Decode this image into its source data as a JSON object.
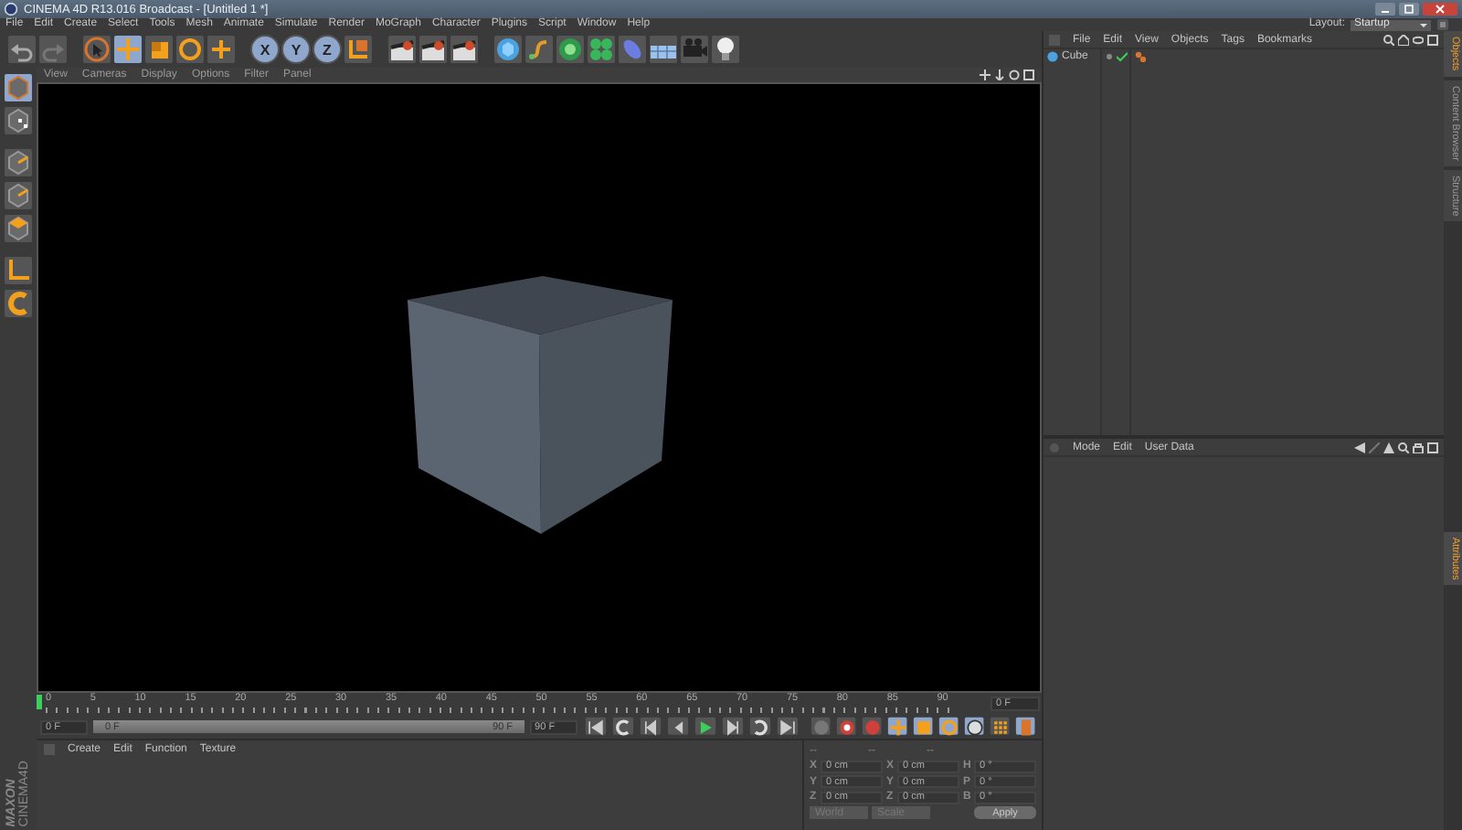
{
  "window": {
    "title": "CINEMA 4D R13.016 Broadcast - [Untitled 1 *]"
  },
  "menu": [
    "File",
    "Edit",
    "Create",
    "Select",
    "Tools",
    "Mesh",
    "Animate",
    "Simulate",
    "Render",
    "MoGraph",
    "Character",
    "Plugins",
    "Script",
    "Window",
    "Help"
  ],
  "layout": {
    "label": "Layout:",
    "value": "Startup"
  },
  "toolbar": {
    "axis_buttons": [
      {
        "label": "X",
        "selected": true
      },
      {
        "label": "Y",
        "selected": true
      },
      {
        "label": "Z",
        "selected": true
      }
    ]
  },
  "viewport": {
    "menu": [
      "View",
      "Cameras",
      "Display",
      "Options",
      "Filter",
      "Panel"
    ]
  },
  "timeline": {
    "ticks": [
      "0",
      "5",
      "10",
      "15",
      "20",
      "25",
      "30",
      "35",
      "40",
      "45",
      "50",
      "55",
      "60",
      "65",
      "70",
      "75",
      "80",
      "85",
      "90"
    ],
    "current_frame": "0 F",
    "start_field": "0 F",
    "range_slider": {
      "start": "0 F",
      "end": "90 F",
      "level": 1
    },
    "end_field": "90 F"
  },
  "materials": {
    "menu": [
      "Create",
      "Edit",
      "Function",
      "Texture"
    ]
  },
  "logo": {
    "line_1": "MAXON",
    "line_2": "CINEMA4D"
  },
  "coordinates": {
    "headers": [
      "--",
      "--",
      "--"
    ],
    "rows": [
      {
        "position_label": "X",
        "position": "0 cm",
        "size_label": "X",
        "size": "0 cm",
        "rotation_label": "H",
        "rotation": "0 °"
      },
      {
        "position_label": "Y",
        "position": "0 cm",
        "size_label": "Y",
        "size": "0 cm",
        "rotation_label": "P",
        "rotation": "0 °"
      },
      {
        "position_label": "Z",
        "position": "0 cm",
        "size_label": "Z",
        "size": "0 cm",
        "rotation_label": "B",
        "rotation": "0 °"
      }
    ],
    "space": "World",
    "mode": "Scale",
    "apply": "Apply"
  },
  "objects": {
    "menu": [
      "File",
      "Edit",
      "View",
      "Objects",
      "Tags",
      "Bookmarks"
    ],
    "items": [
      {
        "name": "Cube",
        "selected": false
      }
    ]
  },
  "attributes": {
    "menu": [
      "Mode",
      "Edit",
      "User Data"
    ]
  },
  "side_tabs_top": [
    {
      "label": "Objects",
      "selected": true
    },
    {
      "label": "Content Browser",
      "selected": false
    },
    {
      "label": "Structure",
      "selected": false
    }
  ],
  "side_tabs_bottom": [
    {
      "label": "Attributes",
      "selected": true
    }
  ]
}
